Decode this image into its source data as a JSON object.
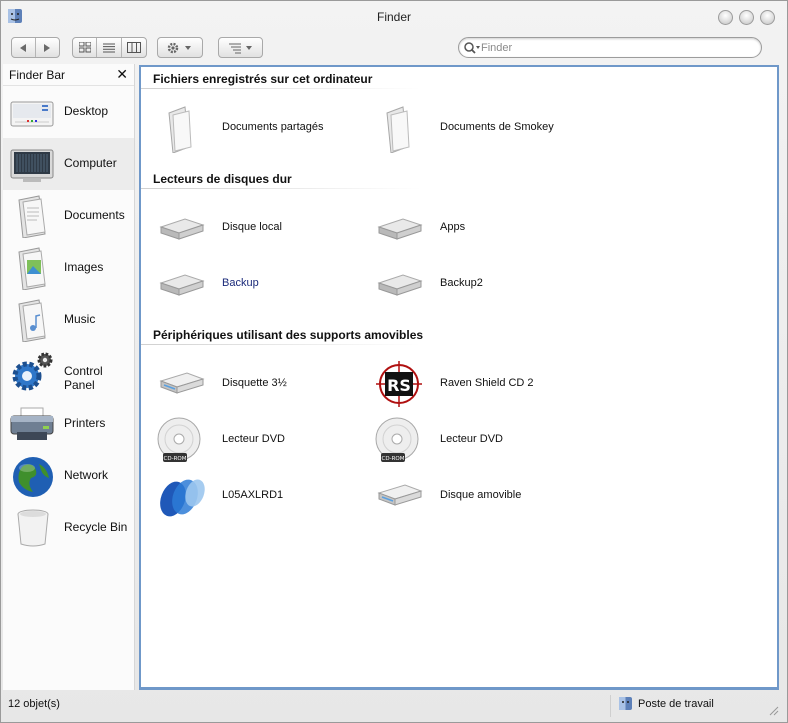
{
  "window": {
    "title": "Finder"
  },
  "toolbar": {
    "back_icon": "back-arrow-icon",
    "forward_icon": "forward-arrow-icon",
    "views": [
      "icon-view-icon",
      "list-view-icon",
      "column-view-icon"
    ],
    "action_icon": "gear-icon",
    "arrange_icon": "arrange-icon"
  },
  "search": {
    "placeholder": "Finder",
    "value": ""
  },
  "sidebar": {
    "header": "Finder Bar",
    "close_label": "✕",
    "items": [
      {
        "label": "Desktop",
        "icon": "desktop-icon",
        "selected": false
      },
      {
        "label": "Computer",
        "icon": "computer-icon",
        "selected": true
      },
      {
        "label": "Documents",
        "icon": "documents-icon",
        "selected": false
      },
      {
        "label": "Images",
        "icon": "images-icon",
        "selected": false
      },
      {
        "label": "Music",
        "icon": "music-icon",
        "selected": false
      },
      {
        "label": "Control Panel",
        "icon": "control-panel-icon",
        "selected": false
      },
      {
        "label": "Printers",
        "icon": "printer-icon",
        "selected": false
      },
      {
        "label": "Network",
        "icon": "network-globe-icon",
        "selected": false
      },
      {
        "label": "Recycle Bin",
        "icon": "recycle-bin-icon",
        "selected": false
      }
    ]
  },
  "sections": [
    {
      "title": "Fichiers enregistrés sur cet ordinateur",
      "items": [
        {
          "label": "Documents partagés",
          "icon": "folder-icon"
        },
        {
          "label": "Documents de Smokey",
          "icon": "folder-icon"
        }
      ]
    },
    {
      "title": "Lecteurs de disques dur",
      "items": [
        {
          "label": "Disque local",
          "icon": "hard-drive-icon"
        },
        {
          "label": "Apps",
          "icon": "hard-drive-icon"
        },
        {
          "label": "Backup",
          "icon": "hard-drive-icon",
          "highlight": true
        },
        {
          "label": "Backup2",
          "icon": "hard-drive-icon"
        }
      ]
    },
    {
      "title": "Périphériques utilisant des supports amovibles",
      "items": [
        {
          "label": "Disquette 3½",
          "icon": "floppy-drive-icon"
        },
        {
          "label": "Raven Shield CD 2",
          "icon": "raven-shield-cd-icon",
          "icon_text": "RS"
        },
        {
          "label": "Lecteur DVD",
          "icon": "cd-rom-icon",
          "icon_text": "CD-ROM"
        },
        {
          "label": "Lecteur DVD",
          "icon": "cd-rom-icon",
          "icon_text": "CD-ROM"
        },
        {
          "label": "L05AXLRD1",
          "icon": "blue-disc-logo-icon"
        },
        {
          "label": "Disque amovible",
          "icon": "removable-drive-icon"
        }
      ]
    }
  ],
  "status": {
    "count": "12 objet(s)",
    "location": "Poste de travail",
    "location_icon": "computer-small-icon"
  },
  "colors": {
    "content_border": "#6f98c9",
    "desktop_bg": "#5a9a2e",
    "highlight_text": "#1a2a7a"
  }
}
